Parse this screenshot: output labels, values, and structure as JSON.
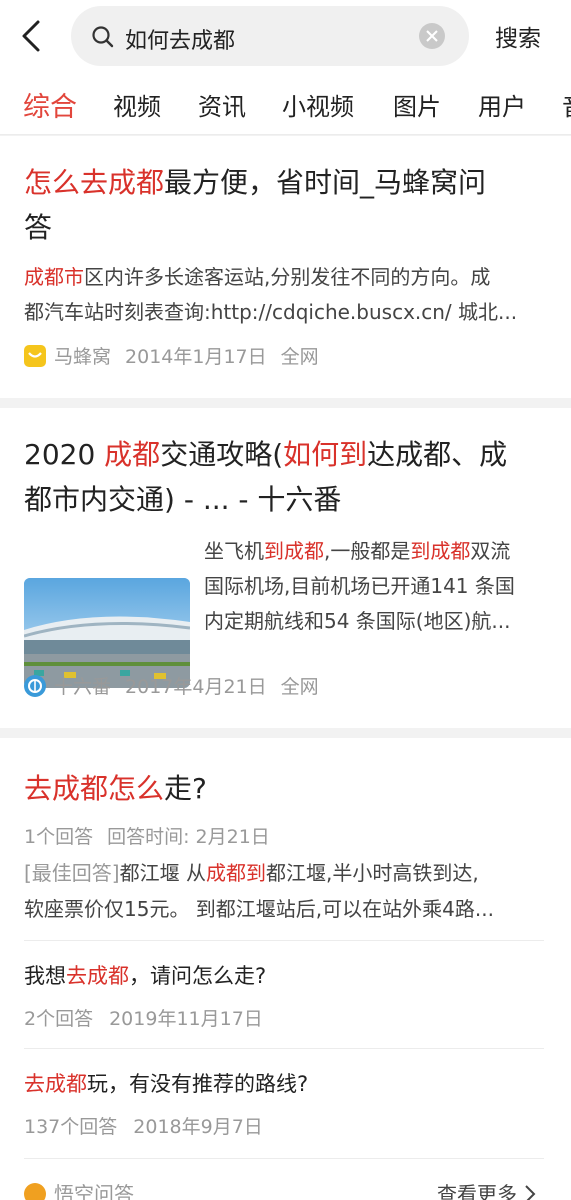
{
  "search": {
    "query": "如何去成都",
    "submit_label": "搜索"
  },
  "tabs": [
    "综合",
    "视频",
    "资讯",
    "小视频",
    "图片",
    "用户",
    "音"
  ],
  "results": [
    {
      "title_highlight": "怎么去成都",
      "title_rest_line1": "最方便，省时间_马蜂窝问",
      "title_line2": "答",
      "abstract_line1_highlight": "成都市",
      "abstract_line1_rest": "区内许多长途客运站,分别发往不同的方向。成",
      "abstract_line2": "都汽车站时刻表查询:http://cdqiche.buscx.cn/ 城北...",
      "source": "马蜂窝",
      "date": "2014年1月17日",
      "scope": "全网",
      "source_icon": "mafengwo-logo-icon"
    },
    {
      "title_l1_a": "2020 ",
      "title_l1_b": "成都",
      "title_l1_c": "交通攻略(",
      "title_l1_d": "如何到",
      "title_l1_e": "达成都、成",
      "title_line2": "都市内交通) - ... - 十六番",
      "abs_l1_a": "坐飞机",
      "abs_l1_b": "到成都",
      "abs_l1_c": ",一般都是",
      "abs_l1_d": "到成都",
      "abs_l1_e": "双流",
      "abs_l2": "国际机场,目前机场已开通141 条国",
      "abs_l3": "内定期航线和54 条国际(地区)航...",
      "source": "十六番",
      "date": "2017年4月21日",
      "scope": "全网",
      "source_icon": "shiliufan-logo-icon"
    }
  ],
  "qa": {
    "title_highlight": "去成都怎么",
    "title_rest": "走?",
    "answers_count": "1个回答",
    "answer_time": "回答时间: 2月21日",
    "best_label": "[最佳回答]",
    "best_l1_a": "都江堰 从",
    "best_l1_b": "成都到",
    "best_l1_c": "都江堰,半小时高铁到达,",
    "best_l2": "软座票价仅15元。 到都江堰站后,可以在站外乘4路...",
    "related": [
      {
        "pre": "我想",
        "hl": "去成都",
        "post": "，请问怎么走?",
        "count": "2个回答",
        "date": "2019年11月17日"
      },
      {
        "pre": "",
        "hl": "去成都",
        "post": "玩，有没有推荐的路线?",
        "count": "137个回答",
        "date": "2018年9月7日"
      }
    ],
    "footer_source": "悟空问答",
    "more_label": "查看更多"
  },
  "colors": {
    "highlight": "#d9322b",
    "tab_active": "#e2463c"
  }
}
